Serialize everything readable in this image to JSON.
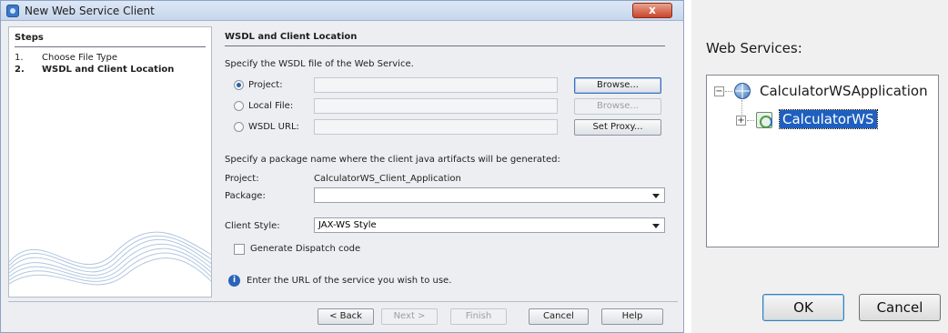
{
  "dialog": {
    "title": "New Web Service Client",
    "close_label": "x",
    "steps": {
      "header": "Steps",
      "items": [
        {
          "num": "1.",
          "label": "Choose File Type"
        },
        {
          "num": "2.",
          "label": "WSDL and Client Location"
        }
      ]
    },
    "section_title": "WSDL and Client Location",
    "specify_wsdl": "Specify the WSDL file of the Web Service.",
    "sources": [
      {
        "label": "Project:",
        "button": "Browse...",
        "selected": true
      },
      {
        "label": "Local File:",
        "button": "Browse...",
        "selected": false
      },
      {
        "label": "WSDL URL:",
        "button": "Set Proxy...",
        "selected": false
      }
    ],
    "package_prompt": "Specify a package name where the client java artifacts will be generated:",
    "project_label": "Project:",
    "project_value": "CalculatorWS_Client_Application",
    "package_label": "Package:",
    "package_value": "",
    "client_style_label": "Client Style:",
    "client_style_value": "JAX-WS Style",
    "dispatch_label": "Generate Dispatch code",
    "info_text": "Enter the URL of the service you wish to use.",
    "buttons": {
      "back": "< Back",
      "next": "Next >",
      "finish": "Finish",
      "cancel": "Cancel",
      "help": "Help"
    }
  },
  "web_services": {
    "label": "Web Services:",
    "tree": {
      "root": "CalculatorWSApplication",
      "child": "CalculatorWS"
    },
    "ok": "OK",
    "cancel": "Cancel"
  }
}
